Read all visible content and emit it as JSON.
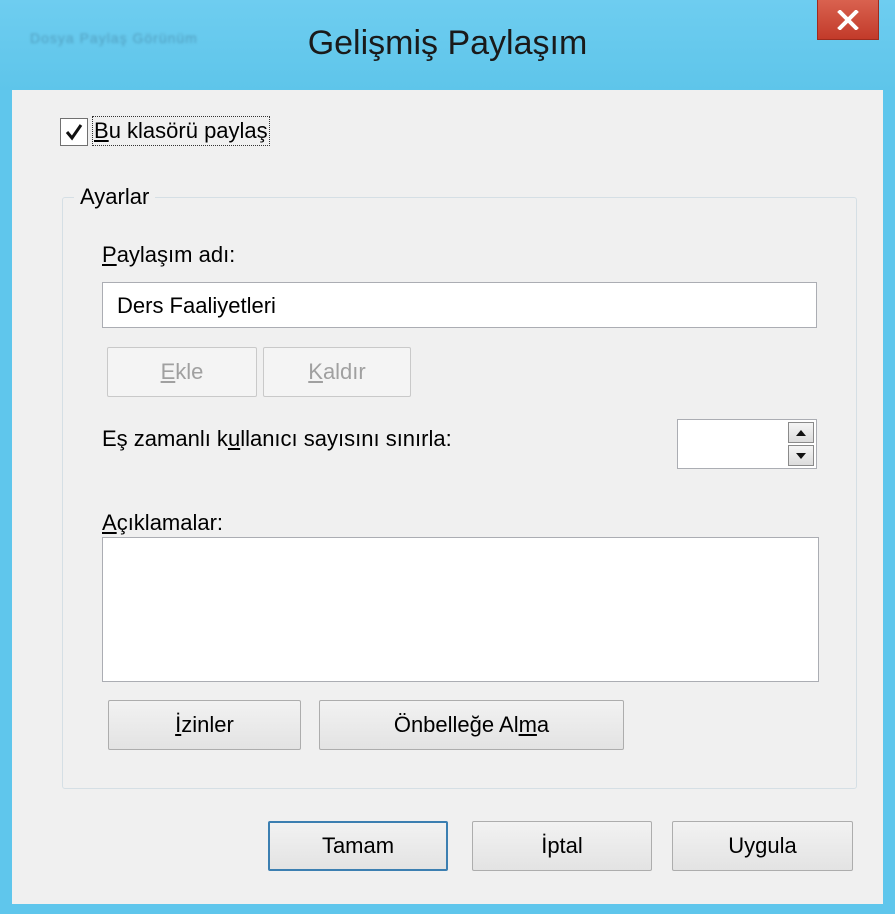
{
  "window": {
    "title": "Gelişmiş Paylaşım",
    "background_menu_hint": "Dosya   Paylaş   Görünüm"
  },
  "share_checkbox": {
    "checked": true,
    "label_prefix": "B",
    "label_rest": "u klasörü paylaş"
  },
  "settings": {
    "legend": "Ayarlar",
    "share_name_label_u": "P",
    "share_name_label_rest": "aylaşım adı:",
    "share_name_value": "Ders Faaliyetleri",
    "add_button_u": "E",
    "add_button_rest": "kle",
    "remove_button_u": "K",
    "remove_button_rest": "aldır",
    "limit_label_a": "Eş zamanlı k",
    "limit_label_u": "u",
    "limit_label_b": "llanıcı sayısını sınırla:",
    "limit_value": "",
    "comments_label_u": "A",
    "comments_label_rest": "çıklamalar:",
    "comments_value": "",
    "permissions_button_u": "İ",
    "permissions_button_rest": "zinler",
    "caching_button_a": "Önbelleğe Al",
    "caching_button_u": "m",
    "caching_button_b": "a"
  },
  "footer": {
    "ok_label": "Tamam",
    "cancel_label": "İptal",
    "apply_label": "Uygula"
  },
  "colors": {
    "titlebar": "#5ec5ea",
    "close": "#c9402e",
    "client": "#f0f0f0",
    "default_button_border": "#3c7fb1"
  },
  "icons": {
    "close": "close-icon",
    "check": "checkmark-icon",
    "spin_up": "spin-up-icon",
    "spin_down": "spin-down-icon"
  }
}
